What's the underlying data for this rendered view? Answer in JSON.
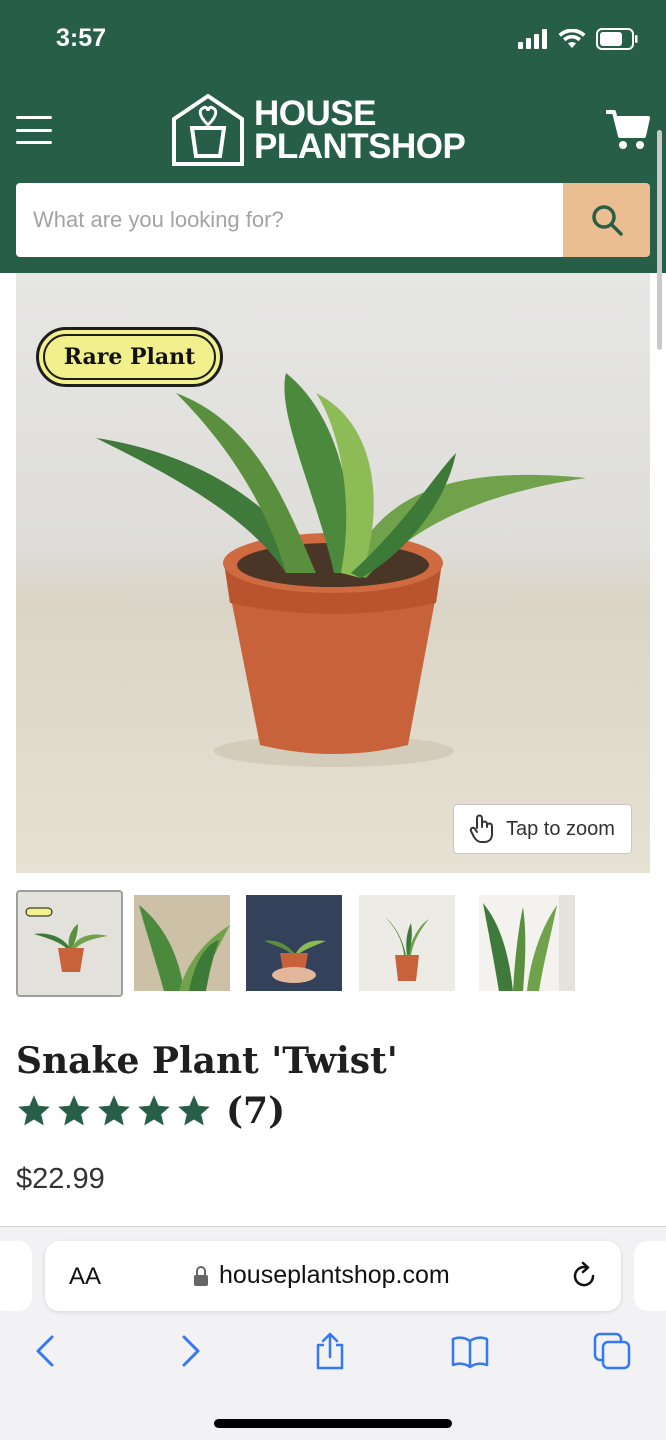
{
  "status_bar": {
    "time": "3:57"
  },
  "header": {
    "logo_line1": "HOUSE",
    "logo_line2": "PLANTSHOP",
    "brand_color": "#275e48",
    "accent_color": "#ebbe91"
  },
  "search": {
    "placeholder": "What are you looking for?"
  },
  "hero": {
    "badge_label": "Rare Plant",
    "zoom_label": "Tap to zoom"
  },
  "product": {
    "title": "Snake Plant 'Twist'",
    "rating_count": "(7)",
    "stars": 5,
    "price": "$22.99"
  },
  "browser": {
    "text_size_label": "AA",
    "url": "houseplantshop.com"
  }
}
